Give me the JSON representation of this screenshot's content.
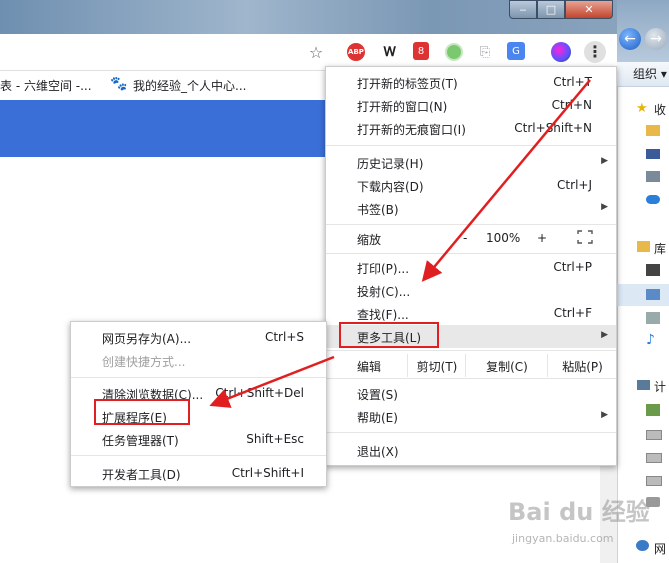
{
  "window_controls": {
    "minimize": "‒",
    "maximize": "□",
    "close": "✕"
  },
  "toolbar": {
    "star": "☆",
    "abp": "ABP",
    "shield": "Ꮃ",
    "red_ext": "8",
    "copy": "⎘",
    "translate": "G",
    "menu": "⋮"
  },
  "bookmarks": {
    "items": [
      {
        "label": "表 - 六维空间 -..."
      },
      {
        "label": "我的经验_个人中心..."
      }
    ],
    "paw_icon": "🐾"
  },
  "explorer": {
    "back": "←",
    "forward": "→",
    "organize": "组织 ▾",
    "items": [
      {
        "label": "收"
      },
      {
        "label": "库"
      },
      {
        "label": "计"
      },
      {
        "label": "网"
      }
    ]
  },
  "main_menu": {
    "items": [
      {
        "label": "打开新的标签页(T)",
        "shortcut": "Ctrl+T"
      },
      {
        "label": "打开新的窗口(N)",
        "shortcut": "Ctrl+N"
      },
      {
        "label": "打开新的无痕窗口(I)",
        "shortcut": "Ctrl+Shift+N"
      },
      {
        "label": "历史记录(H)",
        "shortcut": ""
      },
      {
        "label": "下载内容(D)",
        "shortcut": "Ctrl+J"
      },
      {
        "label": "书签(B)",
        "shortcut": ""
      },
      {
        "label": "打印(P)...",
        "shortcut": "Ctrl+P"
      },
      {
        "label": "投射(C)...",
        "shortcut": ""
      },
      {
        "label": "查找(F)...",
        "shortcut": "Ctrl+F"
      },
      {
        "label": "更多工具(L)",
        "shortcut": ""
      },
      {
        "label": "设置(S)",
        "shortcut": ""
      },
      {
        "label": "帮助(E)",
        "shortcut": ""
      },
      {
        "label": "退出(X)",
        "shortcut": ""
      }
    ],
    "zoom": {
      "label": "缩放",
      "minus": "-",
      "value": "100%",
      "plus": "+"
    },
    "edit": {
      "label": "编辑",
      "cut": "剪切(T)",
      "copy": "复制(C)",
      "paste": "粘贴(P)"
    }
  },
  "sub_menu": {
    "items": [
      {
        "label": "网页另存为(A)...",
        "shortcut": "Ctrl+S"
      },
      {
        "label": "创建快捷方式...",
        "shortcut": ""
      },
      {
        "label": "清除浏览数据(C)...",
        "shortcut": "Ctrl+Shift+Del"
      },
      {
        "label": "扩展程序(E)",
        "shortcut": ""
      },
      {
        "label": "任务管理器(T)",
        "shortcut": "Shift+Esc"
      },
      {
        "label": "开发者工具(D)",
        "shortcut": "Ctrl+Shift+I"
      }
    ]
  },
  "watermark": {
    "text": "Bai du 经验",
    "sub": "jingyan.baidu.com"
  },
  "colors": {
    "accent_blue": "#3a6fd8",
    "annotation_red": "#e02020"
  }
}
